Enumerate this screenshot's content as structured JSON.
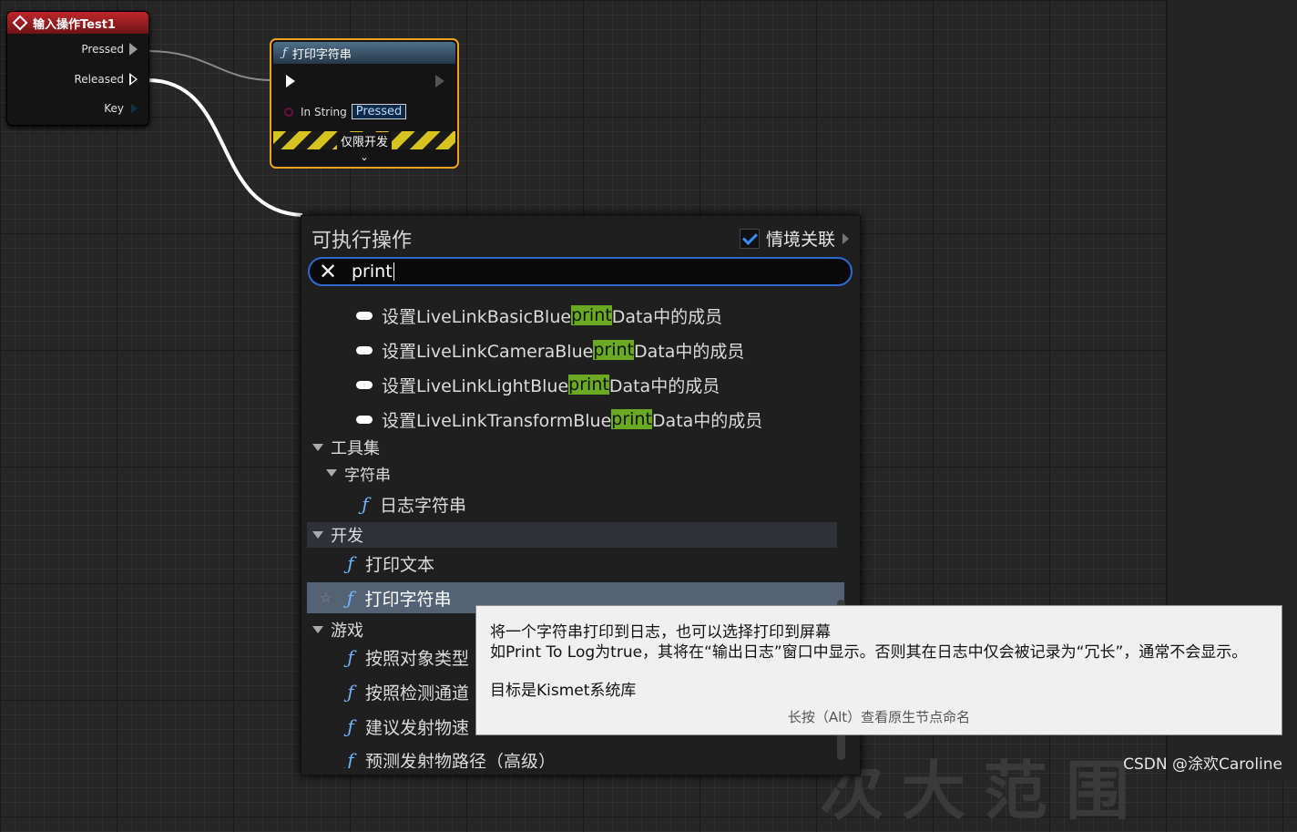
{
  "canvas": {
    "watermark": "CSDN @涂欢Caroline",
    "faded_text": "次大范围"
  },
  "input_node": {
    "title": "输入操作Test1",
    "pins": [
      "Pressed",
      "Released",
      "Key"
    ]
  },
  "print_node": {
    "title": "打印字符串",
    "in_string_label": "In String",
    "in_string_value": "Pressed",
    "dev_only": "仅限开发",
    "expand": "⌄"
  },
  "menu": {
    "title": "可执行操作",
    "context_label": "情境关联",
    "context_checked": true,
    "search_value": "print",
    "items": [
      {
        "kind": "member",
        "pre": "设置LiveLinkBasicBlue",
        "hl": "print",
        "post": "Data中的成员"
      },
      {
        "kind": "member",
        "pre": "设置LiveLinkCameraBlue",
        "hl": "print",
        "post": "Data中的成员"
      },
      {
        "kind": "member",
        "pre": "设置LiveLinkLightBlue",
        "hl": "print",
        "post": "Data中的成员"
      },
      {
        "kind": "member",
        "pre": "设置LiveLinkTransformBlue",
        "hl": "print",
        "post": "Data中的成员"
      },
      {
        "kind": "category",
        "label": "工具集"
      },
      {
        "kind": "subcategory",
        "label": "字符串"
      },
      {
        "kind": "function",
        "label": "日志字符串"
      },
      {
        "kind": "category",
        "label": "开发"
      },
      {
        "kind": "function",
        "label": "打印文本"
      },
      {
        "kind": "function",
        "label": "打印字符串",
        "selected": true
      },
      {
        "kind": "category",
        "label": "游戏"
      },
      {
        "kind": "function",
        "label": "按照对象类型"
      },
      {
        "kind": "function",
        "label": "按照检测通道"
      },
      {
        "kind": "function",
        "label": "建议发射物速"
      },
      {
        "kind": "function",
        "label": "预测发射物路径（高级）"
      }
    ]
  },
  "tooltip": {
    "line1": "将一个字符串打印到日志，也可以选择打印到屏幕",
    "line2": "如Print To Log为true，其将在“输出日志”窗口中显示。否则其在日志中仅会被记录为“冗长”，通常不会显示。",
    "line3": "目标是Kismet系统库",
    "hint": "长按（Alt）查看原生节点命名"
  },
  "colors": {
    "accent": "#2e6ad0",
    "highlight": "#6aaa22",
    "selected_row": "#536375",
    "node_select": "#f0a020"
  }
}
